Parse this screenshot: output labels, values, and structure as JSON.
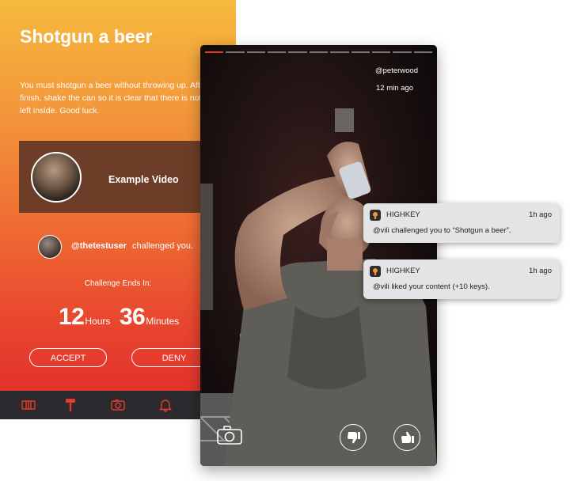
{
  "challenge": {
    "title": "Shotgun a beer",
    "description": "You must shotgun a beer without throwing up. After you finish, shake the can so it is clear that there is nothing left inside. Good luck.",
    "example_label": "Example Video",
    "challenger_name": "@thetestuser",
    "challenger_text": "challenged you.",
    "ends_label": "Challenge Ends In:",
    "hours_value": "12",
    "hours_unit": "Hours",
    "minutes_value": "36",
    "minutes_unit": "Minutes",
    "accept_label": "ACCEPT",
    "deny_label": "DENY"
  },
  "tabbar": {
    "icons": [
      "ticket-icon",
      "hammer-icon",
      "camera-icon",
      "bell-icon"
    ],
    "active_index": 1
  },
  "video": {
    "username": "@peterwood",
    "time": "12 min ago",
    "progress_segments": 11,
    "active_segment": 0
  },
  "notifications": [
    {
      "app": "HIGHKEY",
      "time": "1h ago",
      "message": "@vili challenged you to “Shotgun a beer”."
    },
    {
      "app": "HIGHKEY",
      "time": "1h ago",
      "message": "@vili liked your content (+10 keys)."
    }
  ],
  "colors": {
    "accent": "#e53a2c",
    "gradient_top": "#f6ba3e",
    "gradient_bottom": "#df2b2b",
    "tabbar": "#2b2a2e"
  }
}
